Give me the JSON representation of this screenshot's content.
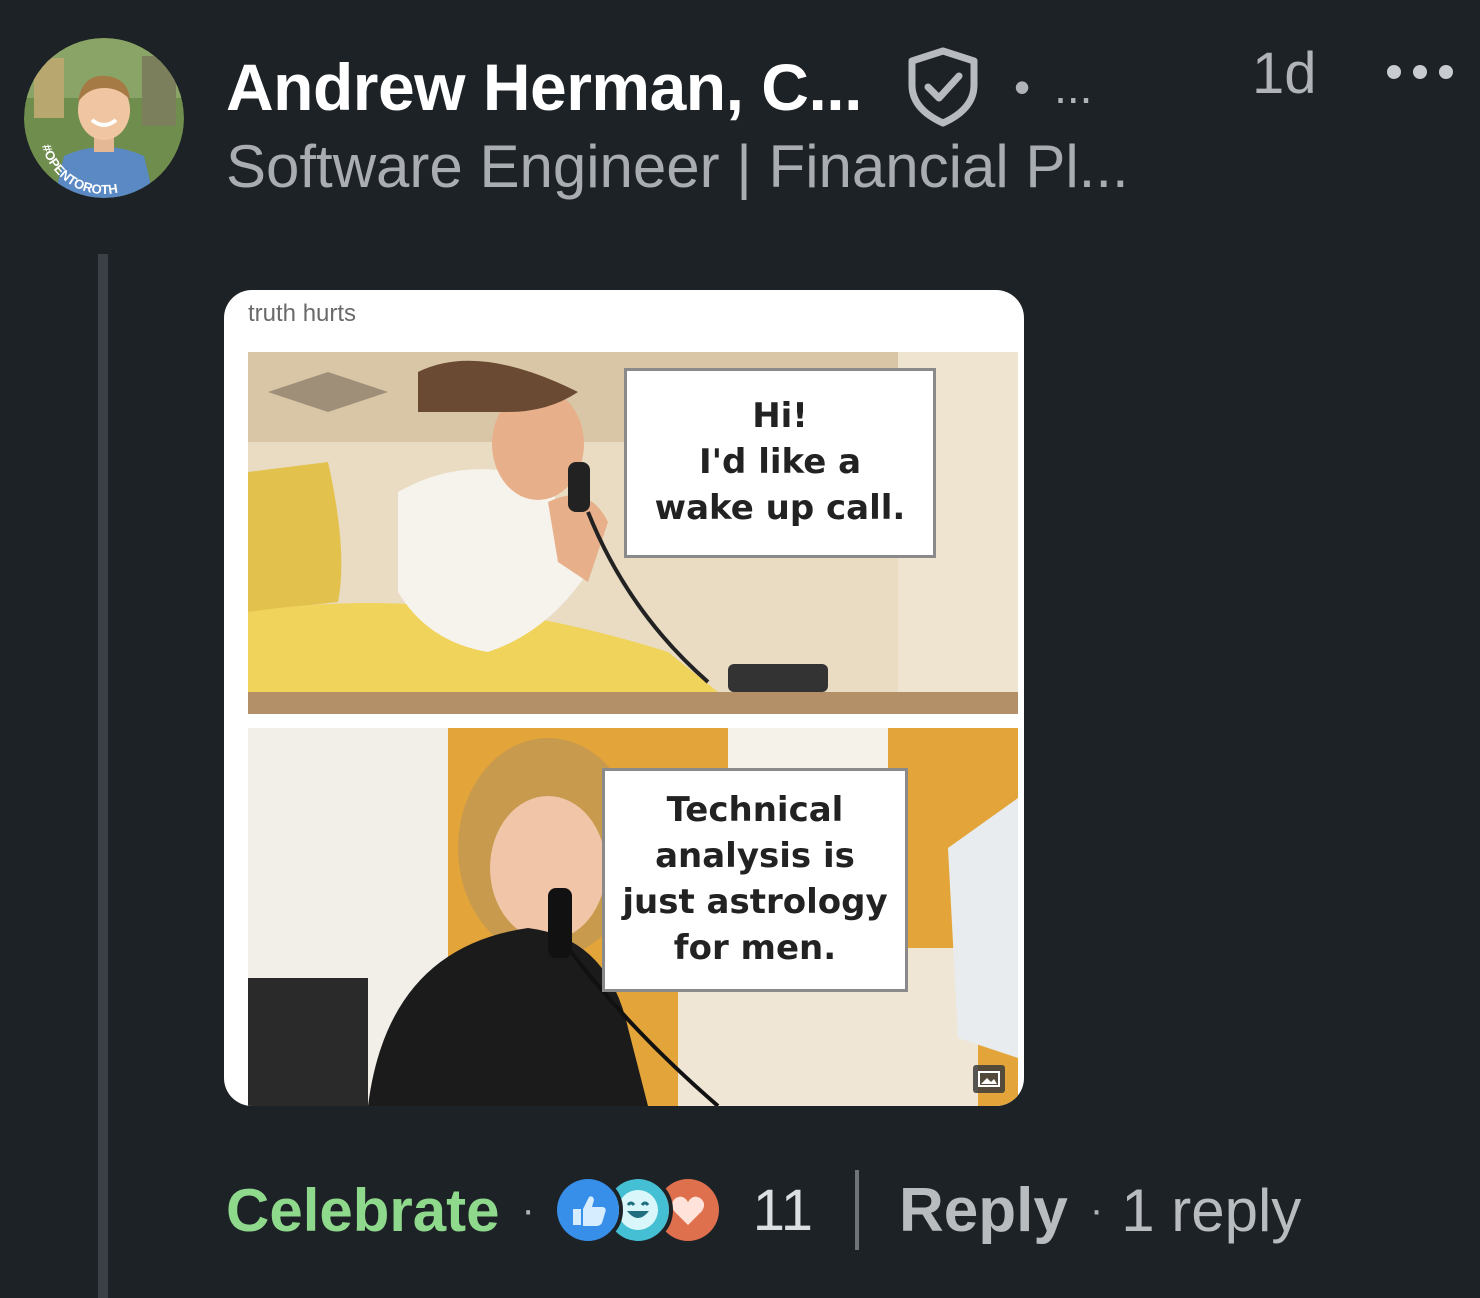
{
  "comment": {
    "author": {
      "name": "Andrew Herman, C...",
      "avatar_badge_text": "#OPENTOROTH",
      "degree": "...",
      "headline": "Software Engineer | Financial Pl..."
    },
    "separator": "•",
    "timestamp": "1d",
    "more_icon": "more-horizontal-icon",
    "verified_icon": "verified-shield-icon",
    "attachment": {
      "caption": "truth hurts",
      "top_bubble": "Hi!\nI'd like a\nwake up call.",
      "bottom_bubble": "Technical\nanalysis is\njust astrology\nfor men."
    },
    "actions": {
      "reaction_label": "Celebrate",
      "separator": "·",
      "reaction_icons": [
        "like-icon",
        "funny-icon",
        "love-icon"
      ],
      "reaction_count": "11",
      "reply_label": "Reply",
      "reply_separator": "·",
      "reply_count": "1 reply"
    },
    "colors": {
      "background": "#1d2226",
      "celebrate": "#8fd98c",
      "like": "#378fe9",
      "funny": "#44bfd3",
      "love": "#df704d"
    }
  }
}
